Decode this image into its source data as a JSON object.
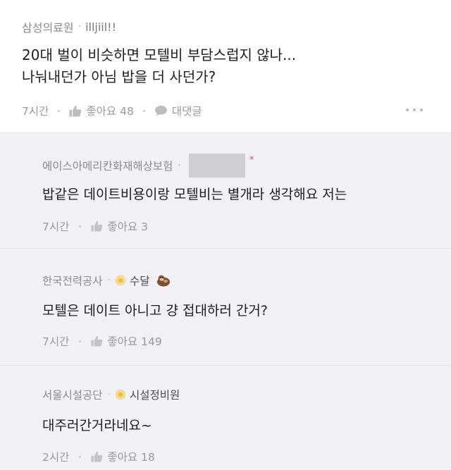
{
  "post": {
    "company": "삼성의료원",
    "nickname": "illjiil!!",
    "body_lines": [
      "20대 벌이 비슷하면 모텔비 부담스럽지 않나...",
      "나눠내던가 아님 밥을 더 사던가?"
    ],
    "time": "7시간",
    "like_label": "좋아요 48",
    "reply_label": "대댓글"
  },
  "comments": [
    {
      "company": "에이스아메리칸화재해상보험",
      "nickname": "",
      "text": "밥같은 데이트비용이랑 모텔비는 별개라 생각해요 저는",
      "time": "7시간",
      "like_label": "좋아요 3"
    },
    {
      "company": "한국전력공사",
      "nickname": "수달",
      "text": "모텔은 데이트 아니고 걍 접대하러 간거?",
      "time": "7시간",
      "like_label": "좋아요 149"
    },
    {
      "company": "서울시설공단",
      "nickname": "시설정비원",
      "text": "대주러간거라네요~",
      "time": "2시간",
      "like_label": "좋아요 18"
    }
  ],
  "icons": {
    "like": "thumbs-up-icon",
    "reply": "speech-bubble-icon",
    "more": "more-dots-icon",
    "badge": "badge-icon",
    "otter": "otter-emoji-icon"
  },
  "colors": {
    "background": "#f2f2f6",
    "post_background": "#ffffff",
    "meta_text": "#999999",
    "body_text": "#1e1e1e",
    "star": "#e24b4b"
  }
}
